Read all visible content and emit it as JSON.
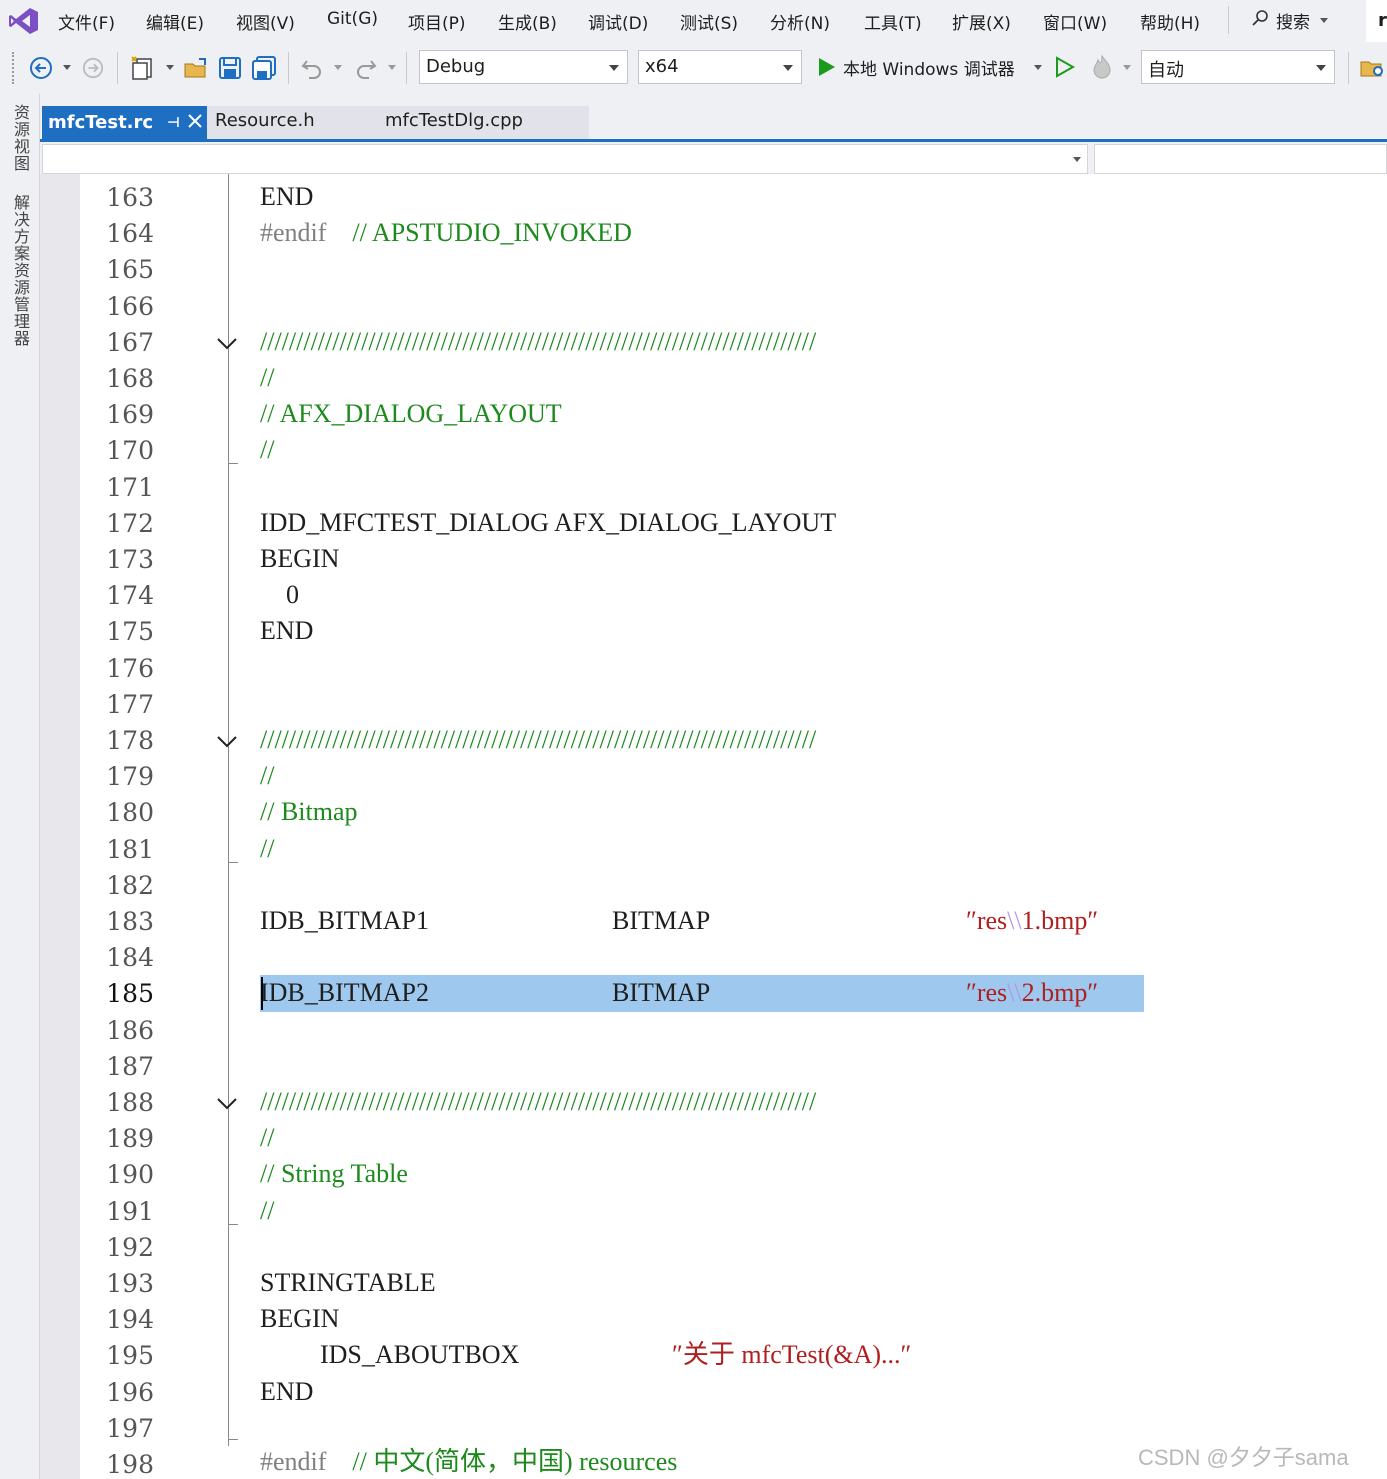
{
  "menu": [
    "文件(F)",
    "编辑(E)",
    "视图(V)",
    "Git(G)",
    "项目(P)",
    "生成(B)",
    "调试(D)",
    "测试(S)",
    "分析(N)",
    "工具(T)",
    "扩展(X)",
    "窗口(W)",
    "帮助(H)"
  ],
  "search_label": "搜索",
  "solution_badge": "r",
  "toolbar": {
    "configuration": "Debug",
    "platform": "x64",
    "run_label": "本地 Windows 调试器",
    "mode": "自动"
  },
  "rail_tabs": [
    "资源视图",
    "解决方案资源管理器"
  ],
  "tabs": {
    "active": "mfcTest.rc",
    "second": "Resource.h",
    "third": "mfcTestDlg.cpp"
  },
  "current_line": "185",
  "lines": [
    {
      "num": "163",
      "kind": "code",
      "a": "END"
    },
    {
      "num": "164",
      "kind": "endif",
      "a": "#endif",
      "b": "// APSTUDIO_INVOKED"
    },
    {
      "num": "165",
      "kind": "blank"
    },
    {
      "num": "166",
      "kind": "blank"
    },
    {
      "num": "167",
      "kind": "rule",
      "a": "/////////////////////////////////////////////////////////////////////////////"
    },
    {
      "num": "168",
      "kind": "comment",
      "a": "//"
    },
    {
      "num": "169",
      "kind": "comment",
      "a": "// AFX_DIALOG_LAYOUT"
    },
    {
      "num": "170",
      "kind": "comment",
      "a": "//"
    },
    {
      "num": "171",
      "kind": "blank"
    },
    {
      "num": "172",
      "kind": "code",
      "a": "IDD_MFCTEST_DIALOG AFX_DIALOG_LAYOUT"
    },
    {
      "num": "173",
      "kind": "code",
      "a": "BEGIN"
    },
    {
      "num": "174",
      "kind": "code",
      "a": "    0"
    },
    {
      "num": "175",
      "kind": "code",
      "a": "END"
    },
    {
      "num": "176",
      "kind": "blank"
    },
    {
      "num": "177",
      "kind": "blank"
    },
    {
      "num": "178",
      "kind": "rule",
      "a": "/////////////////////////////////////////////////////////////////////////////"
    },
    {
      "num": "179",
      "kind": "comment",
      "a": "//"
    },
    {
      "num": "180",
      "kind": "comment",
      "a": "// Bitmap"
    },
    {
      "num": "181",
      "kind": "comment",
      "a": "//"
    },
    {
      "num": "182",
      "kind": "blank"
    },
    {
      "num": "183",
      "kind": "bitmap",
      "a": "IDB_BITMAP1",
      "b": "BITMAP",
      "s1": "res",
      "s2": "\\\\",
      "s3": "1.bmp"
    },
    {
      "num": "184",
      "kind": "blank"
    },
    {
      "num": "185",
      "kind": "bitmap",
      "a": "IDB_BITMAP2",
      "b": "BITMAP",
      "s1": "res",
      "s2": "\\\\",
      "s3": "2.bmp"
    },
    {
      "num": "186",
      "kind": "blank"
    },
    {
      "num": "187",
      "kind": "blank"
    },
    {
      "num": "188",
      "kind": "rule",
      "a": "/////////////////////////////////////////////////////////////////////////////"
    },
    {
      "num": "189",
      "kind": "comment",
      "a": "//"
    },
    {
      "num": "190",
      "kind": "comment",
      "a": "// String Table"
    },
    {
      "num": "191",
      "kind": "comment",
      "a": "//"
    },
    {
      "num": "192",
      "kind": "blank"
    },
    {
      "num": "193",
      "kind": "code",
      "a": "STRINGTABLE"
    },
    {
      "num": "194",
      "kind": "code",
      "a": "BEGIN"
    },
    {
      "num": "195",
      "kind": "strentry",
      "a": "IDS_ABOUTBOX",
      "s1": "关于 mfcTest(&A)..."
    },
    {
      "num": "196",
      "kind": "code",
      "a": "END"
    },
    {
      "num": "197",
      "kind": "blank"
    },
    {
      "num": "198",
      "kind": "endif",
      "a": "#endif",
      "b": "// 中文(简体，中国) resources"
    }
  ],
  "watermark": "CSDN @夕夕子sama",
  "colors": {
    "accent": "#1e6ec2",
    "comment": "#1d8a1d",
    "string": "#b01e1e",
    "escape": "#b894e6",
    "selection": "#9ec8ee"
  }
}
